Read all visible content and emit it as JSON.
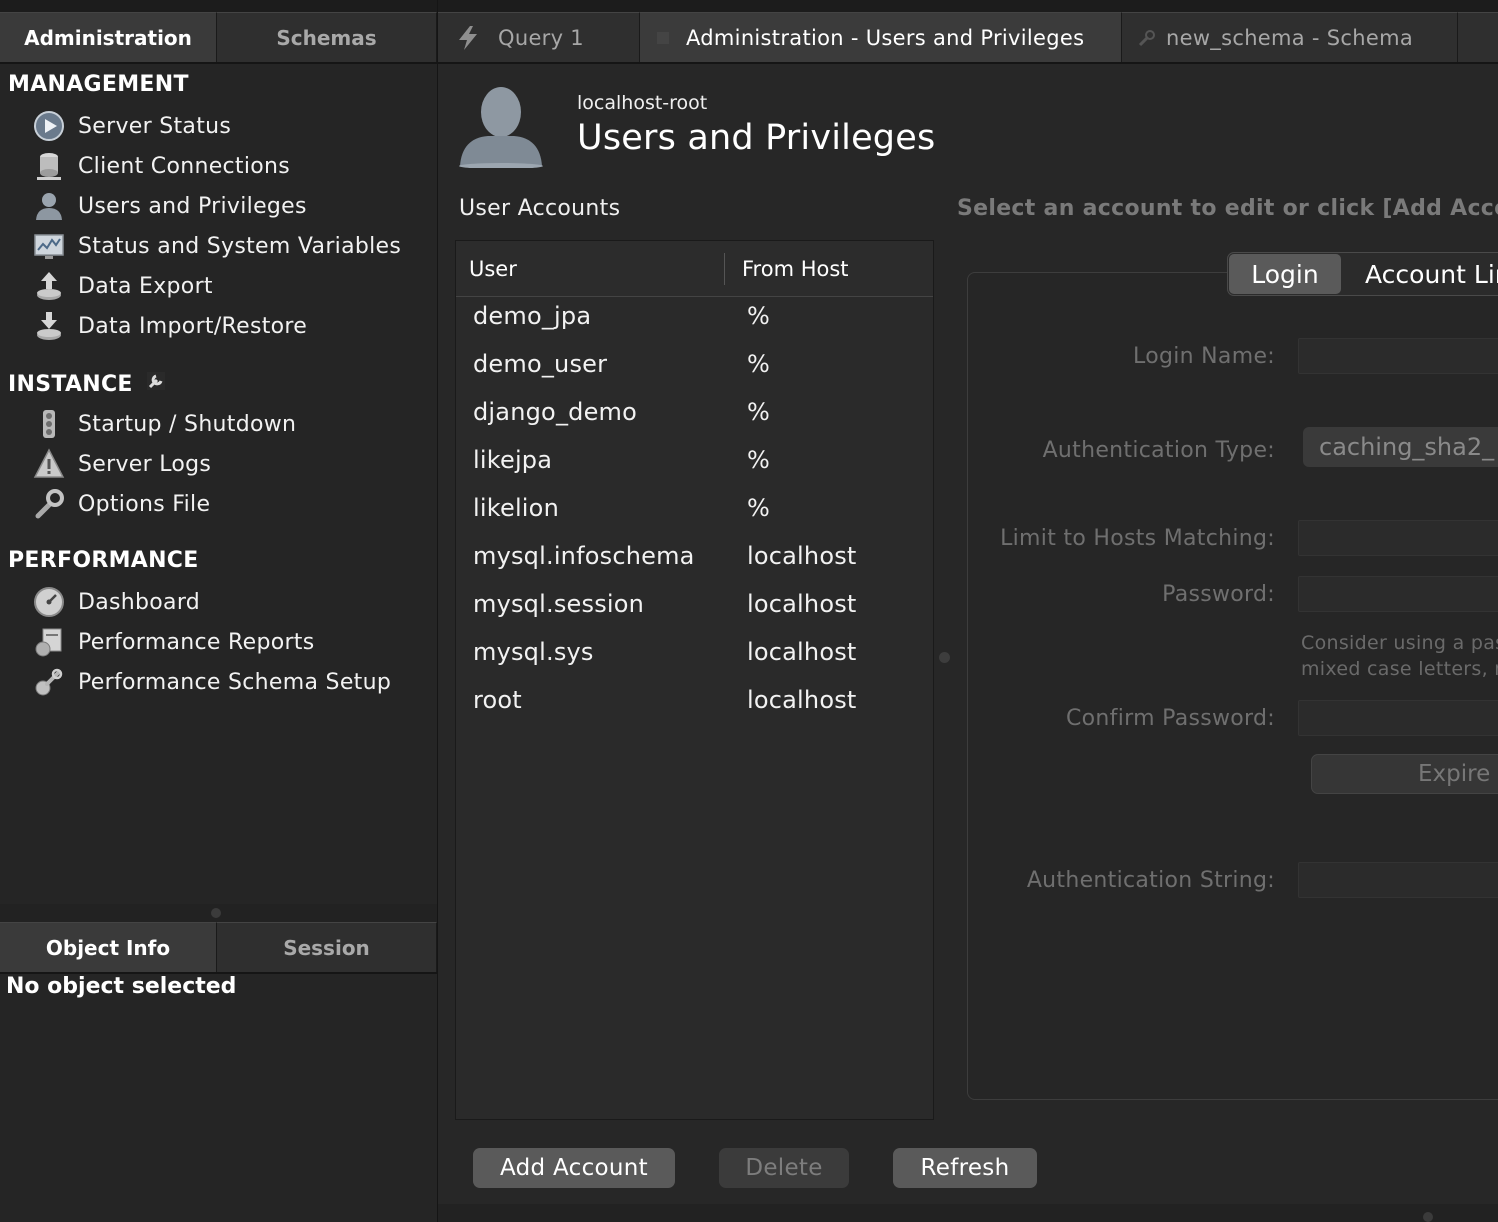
{
  "left_tabs": [
    "Administration",
    "Schemas"
  ],
  "management": {
    "heading": "MANAGEMENT",
    "items": [
      "Server Status",
      "Client Connections",
      "Users and Privileges",
      "Status and System Variables",
      "Data Export",
      "Data Import/Restore"
    ]
  },
  "instance": {
    "heading": "INSTANCE",
    "items": [
      "Startup / Shutdown",
      "Server Logs",
      "Options File"
    ]
  },
  "performance": {
    "heading": "PERFORMANCE",
    "items": [
      "Dashboard",
      "Performance Reports",
      "Performance Schema Setup"
    ]
  },
  "bottom_tabs": [
    "Object Info",
    "Session"
  ],
  "object_info_text": "No object selected",
  "doc_tabs": [
    "Query 1",
    "Administration - Users and Privileges",
    "new_schema - Schema"
  ],
  "header": {
    "connection": "localhost-root",
    "title": "Users and Privileges"
  },
  "user_accounts_label": "User Accounts",
  "select_hint": "Select an account to edit or click [Add Accou",
  "table": {
    "headers": [
      "User",
      "From Host"
    ],
    "rows": [
      {
        "user": "demo_jpa",
        "host": "%"
      },
      {
        "user": "demo_user",
        "host": "%"
      },
      {
        "user": "django_demo",
        "host": "%"
      },
      {
        "user": "likejpa",
        "host": "%"
      },
      {
        "user": "likelion",
        "host": "%"
      },
      {
        "user": "mysql.infoschema",
        "host": "localhost"
      },
      {
        "user": "mysql.session",
        "host": "localhost"
      },
      {
        "user": "mysql.sys",
        "host": "localhost"
      },
      {
        "user": "root",
        "host": "localhost"
      }
    ]
  },
  "detail_tabs": [
    "Login",
    "Account Lir"
  ],
  "form": {
    "login_name": "Login Name:",
    "auth_type": "Authentication Type:",
    "auth_type_value": "caching_sha2_",
    "limit_hosts": "Limit to Hosts Matching:",
    "password": "Password:",
    "password_hint_1": "Consider using a pas",
    "password_hint_2": "mixed case letters, n",
    "confirm_password": "Confirm Password:",
    "expire_label": "Expire P",
    "auth_string": "Authentication String:"
  },
  "buttons": {
    "add": "Add Account",
    "delete": "Delete",
    "refresh": "Refresh"
  },
  "colors": {
    "background": "#272727",
    "sidebar": "#252525",
    "active_tab": "#3b3b3b",
    "button": "#5a5a5a",
    "disabled_text": "#6f6f6f"
  }
}
